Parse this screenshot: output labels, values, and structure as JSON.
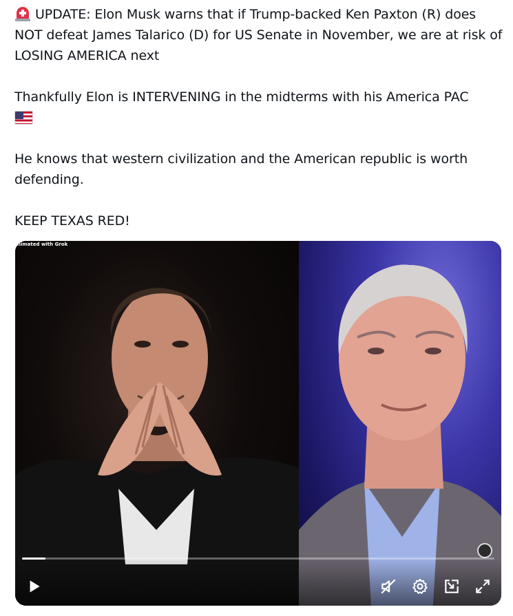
{
  "post": {
    "p1_text": "UPDATE: Elon Musk warns that if Trump-backed Ken Paxton (R) does NOT defeat James Talarico (D) for US Senate in November, we are at risk of LOSING AMERICA next",
    "p1_emoji": "rotating-light-emoji",
    "p2_text": "Thankfully Elon is INTERVENING in the midterms with his America PAC",
    "p2_emoji": "us-flag-emoji",
    "p3_text": "He knows that western civilization and the American republic is worth defending.",
    "p4_text": "KEEP TEXAS RED!"
  },
  "video": {
    "badge": "nimated with Grok",
    "progress": 0.05,
    "left_panel_subject": "man with steepled hands on dark background",
    "right_panel_subject": "man in suit on purple background",
    "controls": {
      "play_icon": "play-icon",
      "mute_icon": "muted-speaker-icon",
      "settings_icon": "gear-icon",
      "pip_icon": "picture-in-picture-icon",
      "fullscreen_icon": "expand-icon"
    }
  }
}
